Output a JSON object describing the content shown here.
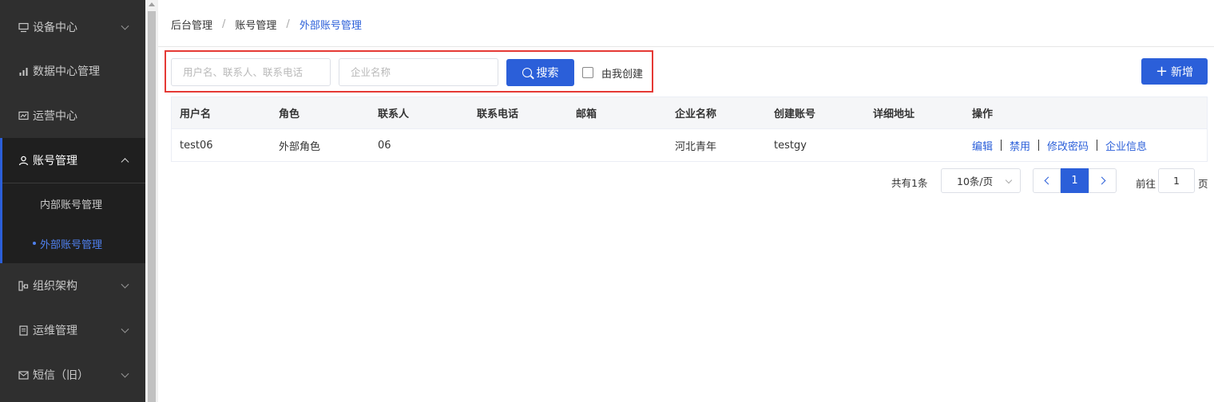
{
  "sidebar": {
    "items": [
      {
        "label": "设备中心",
        "icon": "monitor-icon"
      },
      {
        "label": "数据中心管理",
        "icon": "bar-chart-icon"
      },
      {
        "label": "运营中心",
        "icon": "trend-chart-icon"
      },
      {
        "label": "账号管理",
        "icon": "user-icon"
      },
      {
        "label": "组织架构",
        "icon": "org-icon"
      },
      {
        "label": "运维管理",
        "icon": "document-icon"
      },
      {
        "label": "短信（旧）",
        "icon": "mail-icon"
      }
    ],
    "submenu": [
      {
        "label": "内部账号管理"
      },
      {
        "label": "外部账号管理"
      }
    ],
    "accent_color": "#2b5fd9"
  },
  "breadcrumb": {
    "items": [
      "后台管理",
      "账号管理",
      "外部账号管理"
    ],
    "separator": "/"
  },
  "filters": {
    "user_placeholder": "用户名、联系人、联系电话",
    "company_placeholder": "企业名称",
    "search_label": "搜索",
    "created_by_me_label": "由我创建",
    "created_by_me_checked": false
  },
  "toolbar": {
    "add_label": "新增"
  },
  "table": {
    "headers": [
      "用户名",
      "角色",
      "联系人",
      "联系电话",
      "邮箱",
      "企业名称",
      "创建账号",
      "详细地址",
      "操作"
    ],
    "rows": [
      {
        "cells": [
          "test06",
          "外部角色",
          "06",
          "",
          "",
          "河北青年",
          "testgy",
          ""
        ],
        "actions": [
          "编辑",
          "禁用",
          "修改密码",
          "企业信息"
        ]
      }
    ]
  },
  "pagination": {
    "total": "共有1条",
    "page_size": "10条/页",
    "current_page": "1",
    "goto_label": "前往",
    "goto_value": "1",
    "page_suffix": "页"
  }
}
